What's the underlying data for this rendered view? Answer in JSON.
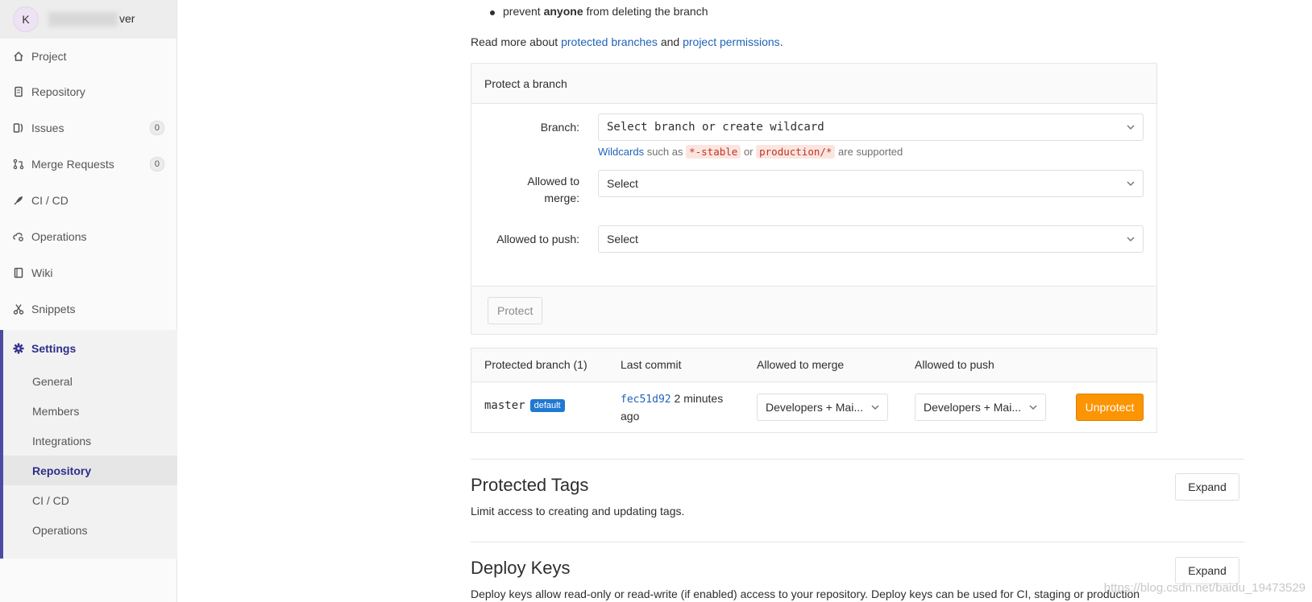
{
  "sidebar": {
    "avatar_letter": "K",
    "project_name_suffix": "ver",
    "items": [
      {
        "label": "Project",
        "icon": "home-icon"
      },
      {
        "label": "Repository",
        "icon": "doc-icon"
      },
      {
        "label": "Issues",
        "icon": "issues-icon",
        "badge": "0"
      },
      {
        "label": "Merge Requests",
        "icon": "merge-request-icon",
        "badge": "0"
      },
      {
        "label": "CI / CD",
        "icon": "rocket-icon"
      },
      {
        "label": "Operations",
        "icon": "cloud-gear-icon"
      },
      {
        "label": "Wiki",
        "icon": "book-icon"
      },
      {
        "label": "Snippets",
        "icon": "scissors-icon"
      }
    ],
    "settings": {
      "label": "Settings",
      "subitems": [
        "General",
        "Members",
        "Integrations",
        "Repository",
        "CI / CD",
        "Operations"
      ],
      "active": "Repository"
    }
  },
  "intro": {
    "bullet_prefix": "prevent ",
    "bullet_bold": "anyone",
    "bullet_suffix": " from deleting the branch",
    "readmore_prefix": "Read more about ",
    "link1": "protected branches",
    "readmore_mid": " and ",
    "link2": "project permissions",
    "readmore_suffix": "."
  },
  "protect_form": {
    "title": "Protect a branch",
    "branch_label": "Branch:",
    "branch_placeholder": "Select branch or create wildcard",
    "hint_link": "Wildcards",
    "hint_text1": " such as ",
    "hint_code1": "*-stable",
    "hint_text2": " or ",
    "hint_code2": "production/*",
    "hint_text3": " are supported",
    "merge_label": "Allowed to merge:",
    "merge_value": "Select",
    "push_label": "Allowed to push:",
    "push_value": "Select",
    "protect_button": "Protect"
  },
  "table": {
    "headers": [
      "Protected branch (1)",
      "Last commit",
      "Allowed to merge",
      "Allowed to push"
    ],
    "rows": [
      {
        "branch": "master",
        "badge": "default",
        "commit_sha": "fec51d92",
        "commit_time": "2 minutes ago",
        "merge": "Developers + Mai...",
        "push": "Developers + Mai...",
        "action": "Unprotect"
      }
    ]
  },
  "sections": [
    {
      "title": "Protected Tags",
      "desc": "Limit access to creating and updating tags.",
      "button": "Expand"
    },
    {
      "title": "Deploy Keys",
      "desc": "Deploy keys allow read-only or read-write (if enabled) access to your repository. Deploy keys can be used for CI, staging or production",
      "button": "Expand"
    }
  ],
  "watermark": "https://blog.csdn.net/baidu_19473529",
  "colors": {
    "accent": "#2e2e8a",
    "link": "#1f63b8",
    "warning": "#fc9403",
    "badge_blue": "#1f78d1"
  }
}
